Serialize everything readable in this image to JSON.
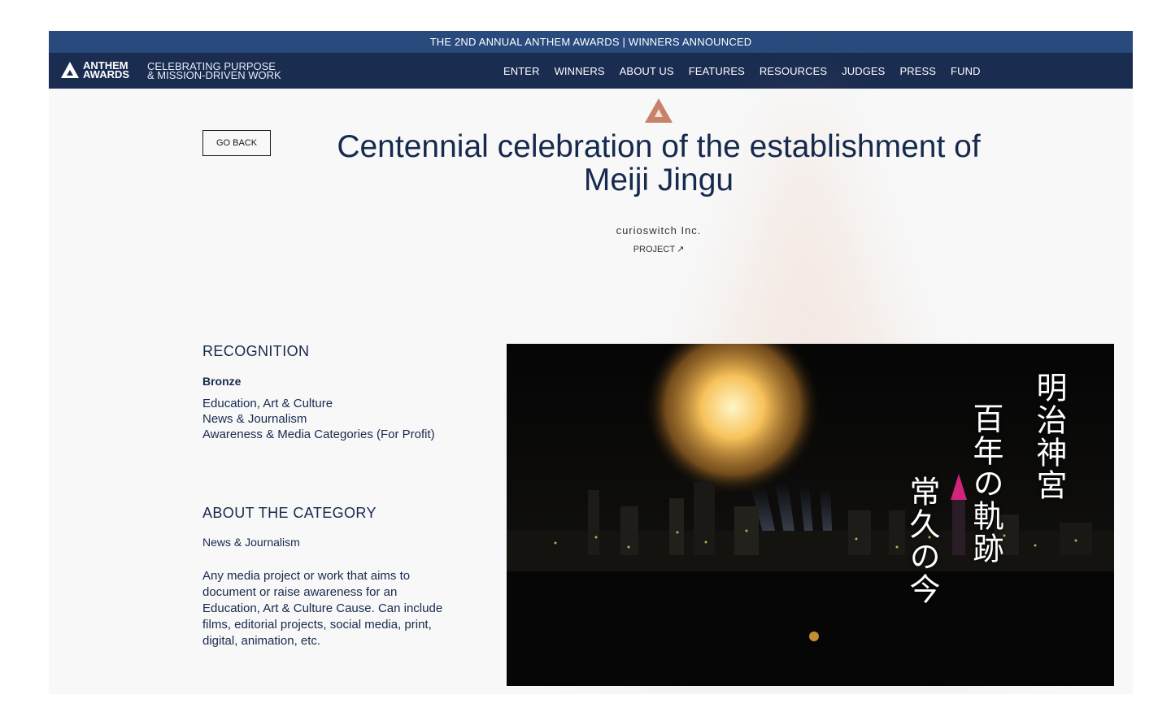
{
  "announcement": "THE 2ND ANNUAL ANTHEM AWARDS | WINNERS ANNOUNCED",
  "brand": {
    "logo_line1": "ANTHEM",
    "logo_line2": "AWARDS",
    "tagline_line1": "CELEBRATING PURPOSE",
    "tagline_line2": "& MISSION-DRIVEN WORK"
  },
  "nav": [
    "ENTER",
    "WINNERS",
    "ABOUT US",
    "FEATURES",
    "RESOURCES",
    "JUDGES",
    "PRESS",
    "FUND"
  ],
  "page": {
    "go_back": "GO BACK",
    "title": "Centennial celebration of the establishment of Meiji Jingu",
    "company": "curioswitch Inc.",
    "project_link": "PROJECT",
    "project_arrow": "↗"
  },
  "recognition": {
    "heading": "RECOGNITION",
    "level": "Bronze",
    "categories": [
      "Education, Art & Culture",
      "News & Journalism",
      "Awareness & Media Categories (For Profit)"
    ]
  },
  "about_category": {
    "heading": "ABOUT THE CATEGORY",
    "name": "News & Journalism",
    "description": "Any media project or work that aims to document or raise awareness for an Education, Art & Culture Cause. Can include films, editorial projects, social media, print, digital, animation, etc."
  },
  "media_overlay": {
    "col1": "明治神宮",
    "col2": "百年の軌跡",
    "col3": "常久の今"
  },
  "colors": {
    "announce_bar": "#284a7c",
    "nav_bar": "#1a2c50",
    "text_navy": "#162a4e",
    "badge": "#c8826a"
  }
}
